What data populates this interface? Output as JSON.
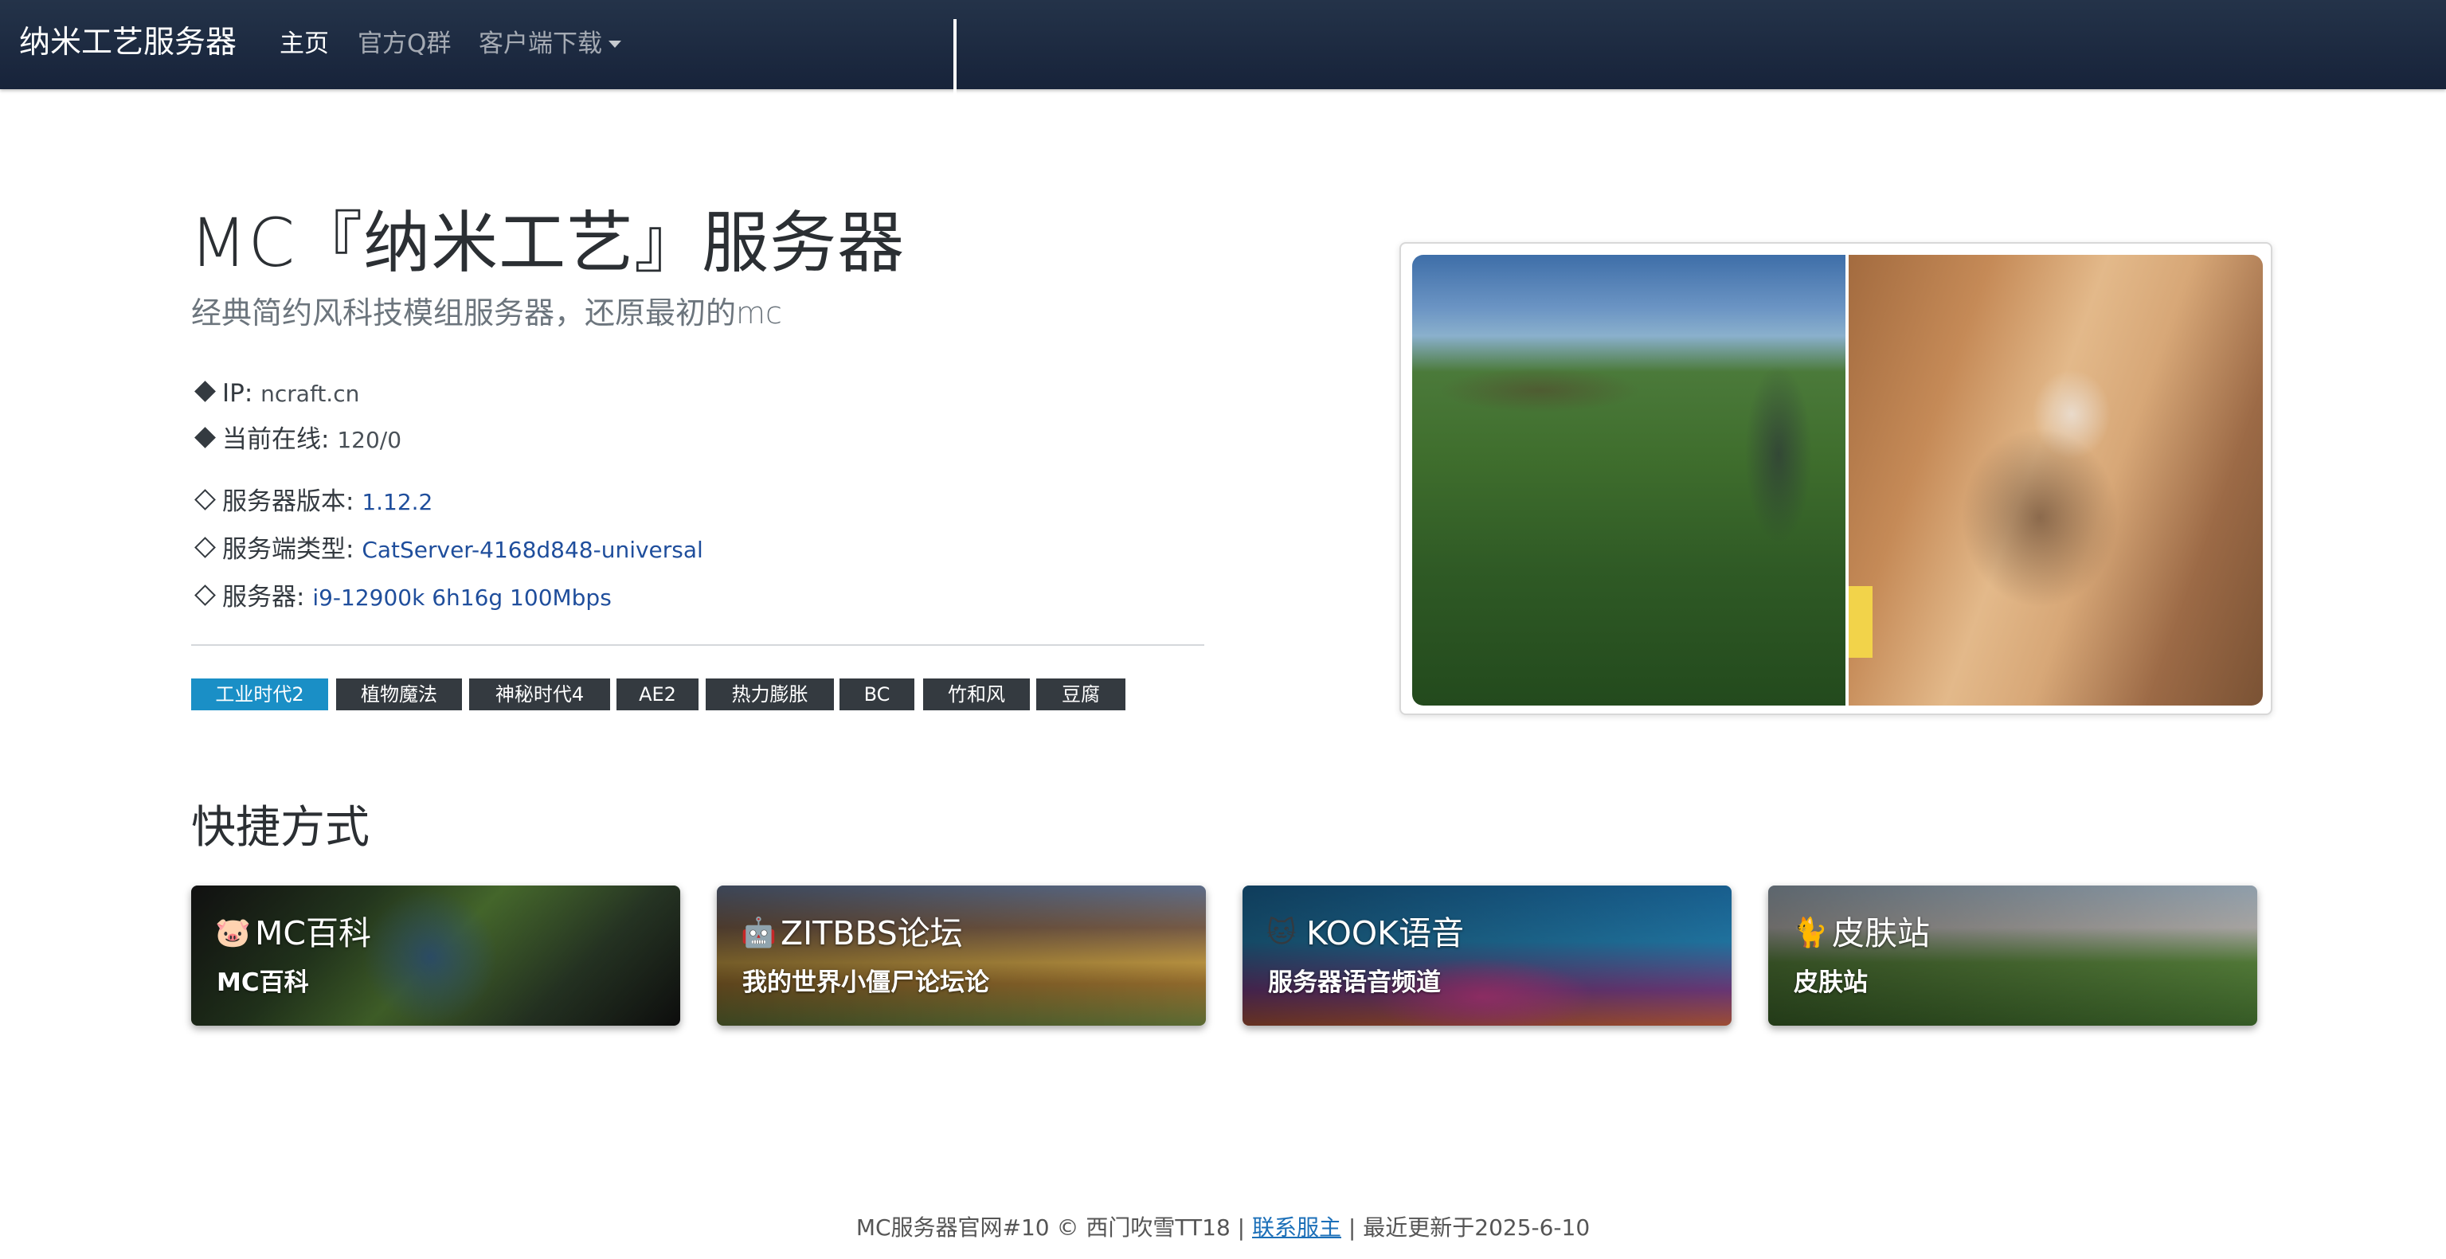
{
  "nav": {
    "brand": "纳米工艺服务器",
    "links": [
      {
        "label": "主页"
      },
      {
        "label": "官方Q群"
      },
      {
        "label": "客户端下载"
      }
    ]
  },
  "hero": {
    "title": "MC『纳米工艺』服务器",
    "subtitle": "经典简约风科技模组服务器，还原最初的mc",
    "ip_label": "IP:",
    "ip_value": "ncraft.cn",
    "online_label": "当前在线:",
    "online_value": "120/0",
    "version_label": "服务器版本:",
    "version_value": "1.12.2",
    "type_label": "服务端类型:",
    "type_value": "CatServer-4168d848-universal",
    "hardware_label": "服务器:",
    "hardware_value": "i9-12900k 6h16g 100Mbps"
  },
  "tags": [
    "工业时代2",
    "植物魔法",
    "神秘时代4",
    "AE2",
    "热力膨胀",
    "BC",
    "竹和风",
    "豆腐"
  ],
  "shortcuts": {
    "title": "快捷方式",
    "cards": [
      {
        "emoji": "🐷",
        "title": "MC百科",
        "subtitle": "MC百科"
      },
      {
        "emoji": "🤖",
        "title": "ZITBBS论坛",
        "subtitle": "我的世界小僵尸论坛论"
      },
      {
        "emoji": "🐱",
        "title": "KOOK语音",
        "subtitle": "服务器语音频道"
      },
      {
        "emoji": "🐈",
        "title": "皮肤站",
        "subtitle": "皮肤站"
      }
    ]
  },
  "footer": {
    "prefix": "MC服务器官网#10 © 西门吹雪TT18 |",
    "link": "联系服主",
    "suffix": "| 最近更新于2025-6-10"
  },
  "colors": {
    "navbar": "#1c2a40",
    "primary_badge": "#1a8fc6",
    "dark_badge": "#343a40",
    "link": "#1f4e9c"
  }
}
